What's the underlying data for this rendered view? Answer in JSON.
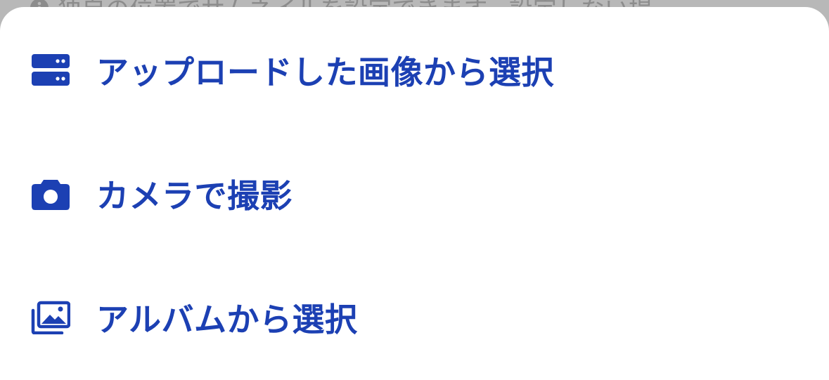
{
  "colors": {
    "accent": "#1c40b3",
    "backdrop": "#b8b8b8",
    "backdrop_text": "#8c8c8c",
    "sheet": "#ffffff"
  },
  "backdrop": {
    "hint_text": "独自の位置でサムネイルを設定できます。設定しない場",
    "hint_icon": "info-icon"
  },
  "sheet": {
    "items": [
      {
        "label": "アップロードした画像から選択",
        "icon": "server-icon"
      },
      {
        "label": "カメラで撮影",
        "icon": "camera-icon"
      },
      {
        "label": "アルバムから選択",
        "icon": "photo-album-icon"
      }
    ]
  }
}
